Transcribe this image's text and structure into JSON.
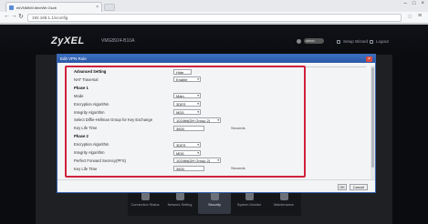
{
  "browser": {
    "tab_title": "ekVNMhM.tbheWb Gsvb",
    "tab_close": "×",
    "url": "192.168.1.1/vconfig",
    "back": "←",
    "forward": "→",
    "reload": "↻",
    "star": "☆",
    "menu": "≡",
    "win_min": "–",
    "win_max": "□",
    "win_close": "×"
  },
  "app": {
    "logo": "ZyXEL",
    "model": "VMG8924-B10A",
    "user_pill": "admin",
    "header_links": [
      "Setup Wizard",
      "Logout"
    ]
  },
  "dock": {
    "items": [
      {
        "label": "Connection Status",
        "active": false
      },
      {
        "label": "Network Setting",
        "active": false
      },
      {
        "label": "Security",
        "active": true
      },
      {
        "label": "System Monitor",
        "active": false
      },
      {
        "label": "Maintenance",
        "active": false
      }
    ]
  },
  "modal": {
    "title": "Edit VPN Rule",
    "close": "×",
    "rows": [
      {
        "label": "Advanced Setting",
        "bold": true,
        "value": "Hide",
        "kind": "text"
      },
      {
        "label": "NAT Traversal",
        "bold": false,
        "value": "Enable",
        "kind": "select"
      },
      {
        "label": "Phase 1",
        "bold": true,
        "value": "",
        "kind": "none"
      },
      {
        "label": "Mode",
        "bold": false,
        "value": "Main",
        "kind": "select"
      },
      {
        "label": "Encryption Algorithm",
        "bold": false,
        "value": "3DES",
        "kind": "select"
      },
      {
        "label": "Integrity Algorithm",
        "bold": false,
        "value": "MD5",
        "kind": "select"
      },
      {
        "label": "Select Diffie-Hellman Group for Key Exchange",
        "bold": false,
        "value": "1024bit(DH Group 2)",
        "kind": "select"
      },
      {
        "label": "Key Life Time",
        "bold": false,
        "value": "3600",
        "kind": "text",
        "unit": "Seconds"
      },
      {
        "label": "Phase 2",
        "bold": true,
        "value": "",
        "kind": "none"
      },
      {
        "label": "Encryption Algorithm",
        "bold": false,
        "value": "3DES",
        "kind": "select"
      },
      {
        "label": "Integrity Algorithm",
        "bold": false,
        "value": "MD5",
        "kind": "select"
      },
      {
        "label": "Perfect Forward Secrecy(PFS)",
        "bold": false,
        "value": "1024bit(DH Group 2)",
        "kind": "select"
      },
      {
        "label": "Key Life Time",
        "bold": false,
        "value": "3600",
        "kind": "text",
        "unit": "Seconds"
      }
    ],
    "ok": "OK",
    "cancel": "Cancel"
  },
  "colors": {
    "highlight": "#d0213d",
    "title_bar": "#2a57a6",
    "app_bg": "#0b0c0f"
  }
}
